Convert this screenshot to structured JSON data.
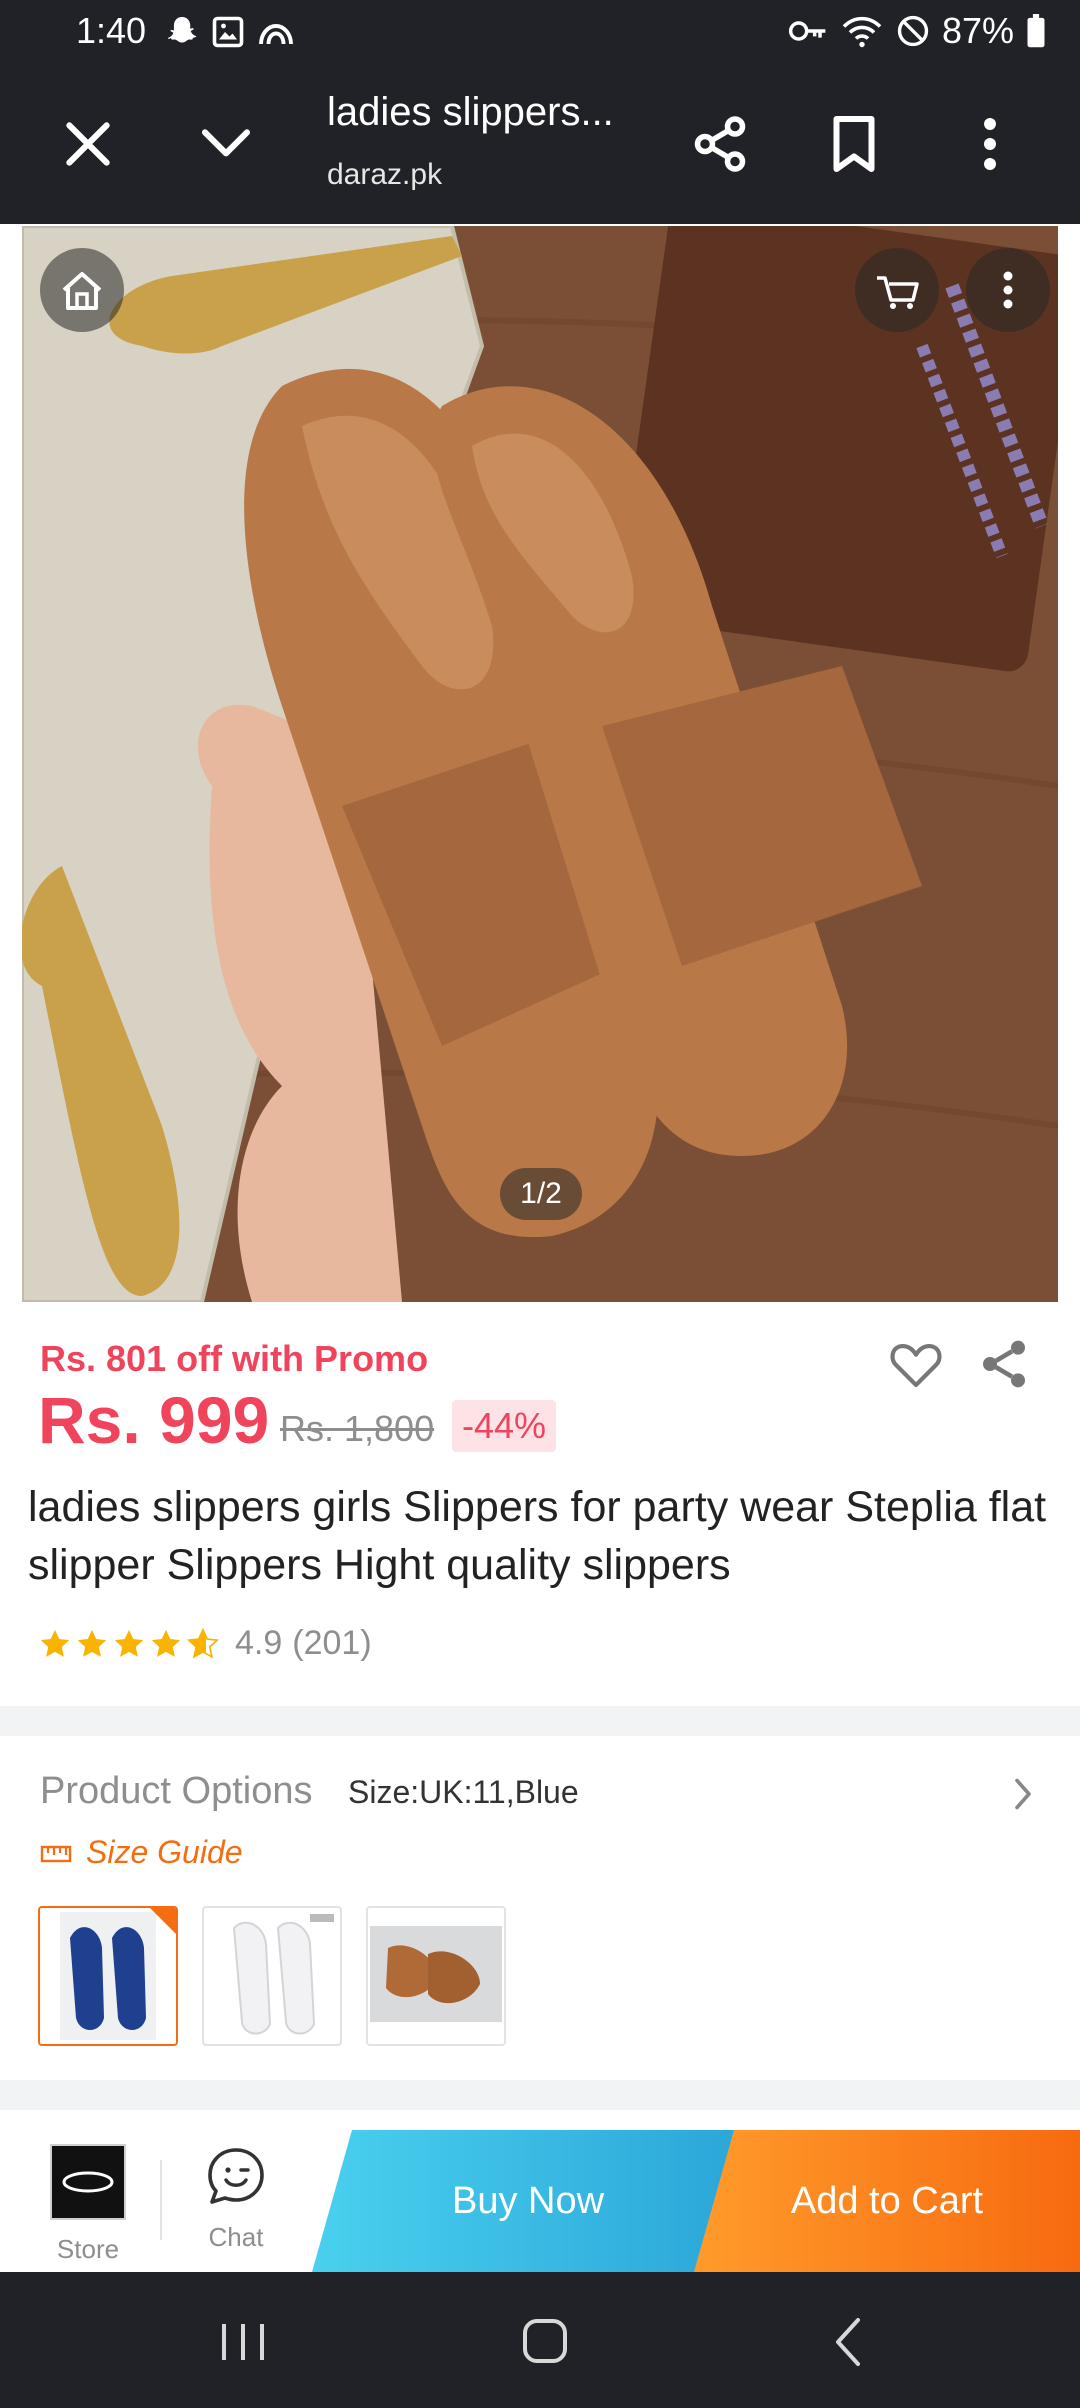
{
  "status_bar": {
    "time": "1:40",
    "battery_percent": "87%",
    "icons_left": [
      "snapchat-icon",
      "gallery-icon",
      "cloud-icon"
    ],
    "icons_right": [
      "vpn-key-icon",
      "wifi-icon",
      "do-not-disturb-icon",
      "battery-icon"
    ]
  },
  "browser": {
    "title": "ladies slippers...",
    "domain": "daraz.pk"
  },
  "product_image": {
    "counter": "1/2"
  },
  "pricing": {
    "promo": "Rs. 801 off with Promo",
    "current": "Rs. 999",
    "original": "Rs. 1,800",
    "discount": "-44%"
  },
  "product": {
    "title": "ladies slippers girls Slippers for party wear Steplia flat slipper Slippers Hight quality slippers",
    "rating_value": "4.9",
    "rating_count": "(201)",
    "stars": 4.9
  },
  "options": {
    "label": "Product Options",
    "value": "Size:UK:11,Blue",
    "size_guide": "Size Guide",
    "variants": [
      "blue",
      "white",
      "tan"
    ]
  },
  "action_bar": {
    "store_label": "Store",
    "chat_label": "Chat",
    "buy_now": "Buy Now",
    "add_to_cart": "Add to Cart"
  },
  "colors": {
    "price_red": "#f0435c",
    "accent_orange": "#f46d12",
    "buy_now_blue": "#2aa6d8",
    "chrome_dark": "#202227"
  }
}
